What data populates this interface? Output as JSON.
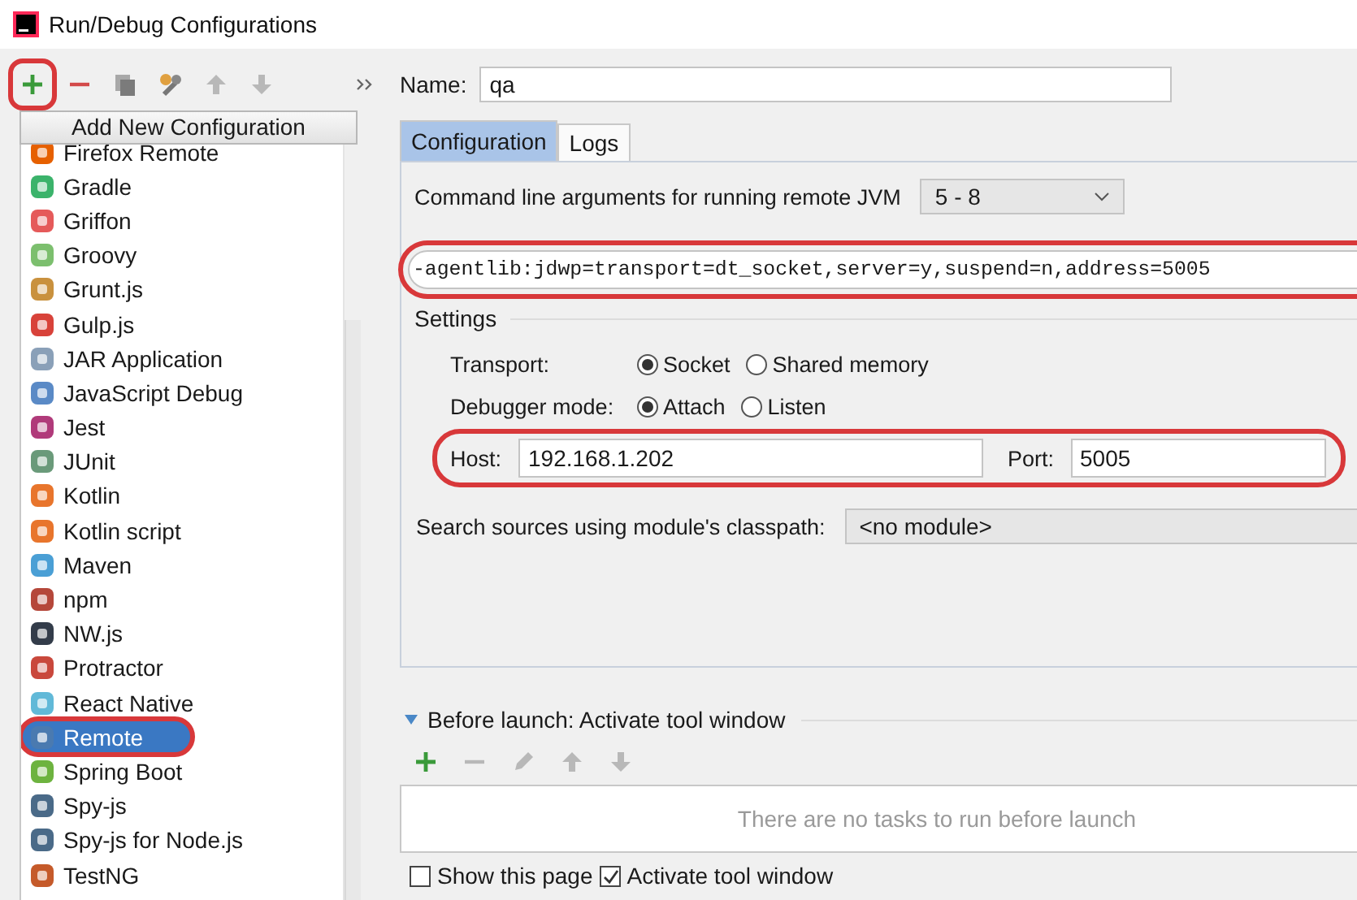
{
  "window": {
    "title": "Run/Debug Configurations"
  },
  "toolbar": [
    {
      "kind": "add",
      "disabled": false,
      "highlighted": true
    },
    {
      "kind": "remove",
      "disabled": false,
      "highlighted": false
    },
    {
      "kind": "copy",
      "disabled": false,
      "highlighted": false
    },
    {
      "kind": "wrench",
      "disabled": false,
      "highlighted": false
    },
    {
      "kind": "up",
      "disabled": true,
      "highlighted": false
    },
    {
      "kind": "down",
      "disabled": true,
      "highlighted": false
    },
    {
      "kind": "more",
      "disabled": false,
      "highlighted": false
    }
  ],
  "config_types": {
    "header": "Add New Configuration",
    "items": [
      {
        "label": "Firefox Remote",
        "selected": false,
        "highlighted": false
      },
      {
        "label": "Gradle",
        "selected": false,
        "highlighted": false
      },
      {
        "label": "Griffon",
        "selected": false,
        "highlighted": false
      },
      {
        "label": "Groovy",
        "selected": false,
        "highlighted": false
      },
      {
        "label": "Grunt.js",
        "selected": false,
        "highlighted": false
      },
      {
        "label": "Gulp.js",
        "selected": false,
        "highlighted": false
      },
      {
        "label": "JAR Application",
        "selected": false,
        "highlighted": false
      },
      {
        "label": "JavaScript Debug",
        "selected": false,
        "highlighted": false
      },
      {
        "label": "Jest",
        "selected": false,
        "highlighted": false
      },
      {
        "label": "JUnit",
        "selected": false,
        "highlighted": false
      },
      {
        "label": "Kotlin",
        "selected": false,
        "highlighted": false
      },
      {
        "label": "Kotlin script",
        "selected": false,
        "highlighted": false
      },
      {
        "label": "Maven",
        "selected": false,
        "highlighted": false
      },
      {
        "label": "npm",
        "selected": false,
        "highlighted": false
      },
      {
        "label": "NW.js",
        "selected": false,
        "highlighted": false
      },
      {
        "label": "Protractor",
        "selected": false,
        "highlighted": false
      },
      {
        "label": "React Native",
        "selected": false,
        "highlighted": false
      },
      {
        "label": "Remote",
        "selected": true,
        "highlighted": true
      },
      {
        "label": "Spring Boot",
        "selected": false,
        "highlighted": false
      },
      {
        "label": "Spy-js",
        "selected": false,
        "highlighted": false
      },
      {
        "label": "Spy-js for Node.js",
        "selected": false,
        "highlighted": false
      },
      {
        "label": "TestNG",
        "selected": false,
        "highlighted": false
      }
    ]
  },
  "name_field": {
    "label": "Name:",
    "value": "qa"
  },
  "tabs": [
    {
      "label": "Configuration",
      "selected": true
    },
    {
      "label": "Logs",
      "selected": false
    }
  ],
  "vm_args": {
    "label": "Command line arguments for running remote JVM",
    "version": "5 - 8",
    "value": "-agentlib:jdwp=transport=dt_socket,server=y,suspend=n,address=5005",
    "highlighted": true
  },
  "settings": {
    "title": "Settings",
    "transport": {
      "label": "Transport:",
      "options": [
        {
          "label": "Socket",
          "selected": true
        },
        {
          "label": "Shared memory",
          "selected": false
        }
      ]
    },
    "debugger_mode": {
      "label": "Debugger mode:",
      "options": [
        {
          "label": "Attach",
          "selected": true
        },
        {
          "label": "Listen",
          "selected": false
        }
      ]
    },
    "host": {
      "label": "Host:",
      "value": "192.168.1.202"
    },
    "port": {
      "label": "Port:",
      "value": "5005"
    },
    "host_port_highlighted": true
  },
  "module": {
    "label": "Search sources using module's classpath:",
    "value": "<no module>"
  },
  "before_launch": {
    "title": "Before launch: Activate tool window",
    "expanded": true,
    "toolbar": [
      {
        "kind": "add",
        "disabled": false
      },
      {
        "kind": "remove",
        "disabled": true
      },
      {
        "kind": "edit",
        "disabled": true
      },
      {
        "kind": "up",
        "disabled": true
      },
      {
        "kind": "down",
        "disabled": true
      }
    ],
    "empty_text": "There are no tasks to run before launch"
  },
  "options": [
    {
      "label": "Show this page",
      "checked": false
    },
    {
      "label": "Activate tool window",
      "checked": true
    }
  ]
}
